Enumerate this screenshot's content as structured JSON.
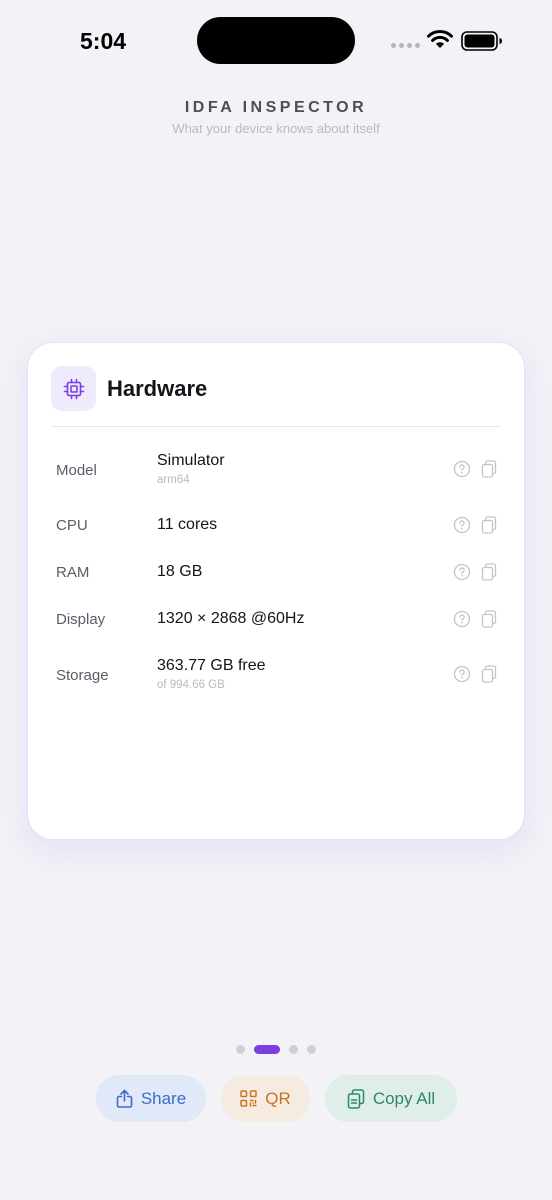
{
  "status_bar": {
    "time": "5:04"
  },
  "header": {
    "title": "IDFA INSPECTOR",
    "subtitle": "What your device knows about itself"
  },
  "card": {
    "icon": "cpu-icon",
    "title": "Hardware",
    "rows": [
      {
        "label": "Model",
        "value": "Simulator",
        "sub": "arm64"
      },
      {
        "label": "CPU",
        "value": "11 cores",
        "sub": ""
      },
      {
        "label": "RAM",
        "value": "18 GB",
        "sub": ""
      },
      {
        "label": "Display",
        "value": "1320 × 2868 @60Hz",
        "sub": ""
      },
      {
        "label": "Storage",
        "value": "363.77 GB free",
        "sub": "of 994.66 GB"
      }
    ],
    "row_icons": [
      "help-icon",
      "copy-icon"
    ]
  },
  "pager": {
    "count": 4,
    "active_index": 1
  },
  "actions": {
    "share_label": "Share",
    "qr_label": "QR",
    "copy_all_label": "Copy All"
  },
  "colors": {
    "accent": "#7b3fe4",
    "share": "#3b6bd0",
    "qr": "#c9771e",
    "copy_all": "#2a8a64"
  }
}
